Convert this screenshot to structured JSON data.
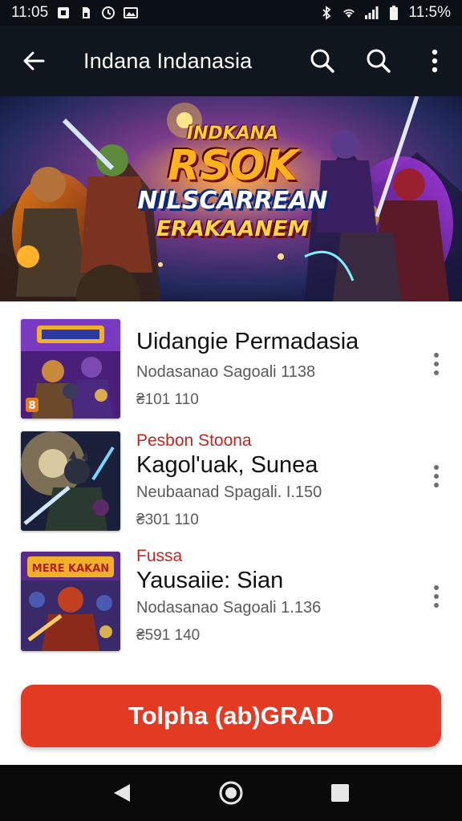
{
  "status_bar": {
    "time": "11:05",
    "battery": "11:5%",
    "icons": [
      "notification-icon",
      "sim-icon",
      "clock-icon",
      "gallery-icon",
      "bluetooth-icon",
      "wifi-icon",
      "signal-icon",
      "battery-icon"
    ]
  },
  "app_bar": {
    "title": "Indana Indanasia",
    "icons": [
      "back-arrow-icon",
      "search-icon",
      "search-icon",
      "more-vert-icon"
    ]
  },
  "banner": {
    "kicker": "INDKANA",
    "headline": "RSOK",
    "line2": "NILSCARREAN",
    "line3": "ERAKAANEM"
  },
  "items": [
    {
      "tag": "",
      "title": "Uidangie Permadasia",
      "meta": "Nodasanao Sagoali 1138",
      "price": "₴101 110",
      "thumb_badge": "8"
    },
    {
      "tag": "Pesbon Stoona",
      "title": "Kagol'uak, Sunea",
      "meta": "Neubaanad Spagali. I.150",
      "price": "₴301 110"
    },
    {
      "tag": "Fussa",
      "title": "Yausaiie: Sian",
      "meta": "Nodasanao Sagoali 1.136",
      "price": "₴591 140",
      "thumb_label": "MERE KAKAN"
    }
  ],
  "cta": {
    "label": "Tolpha (ab)GRAD"
  },
  "nav_bar": {
    "icons": [
      "back-triangle-icon",
      "home-circle-icon",
      "recents-square-icon"
    ]
  },
  "colors": {
    "accent": "#e33a24",
    "tag_red": "#c6231f",
    "app_bar": "#0f161e"
  }
}
